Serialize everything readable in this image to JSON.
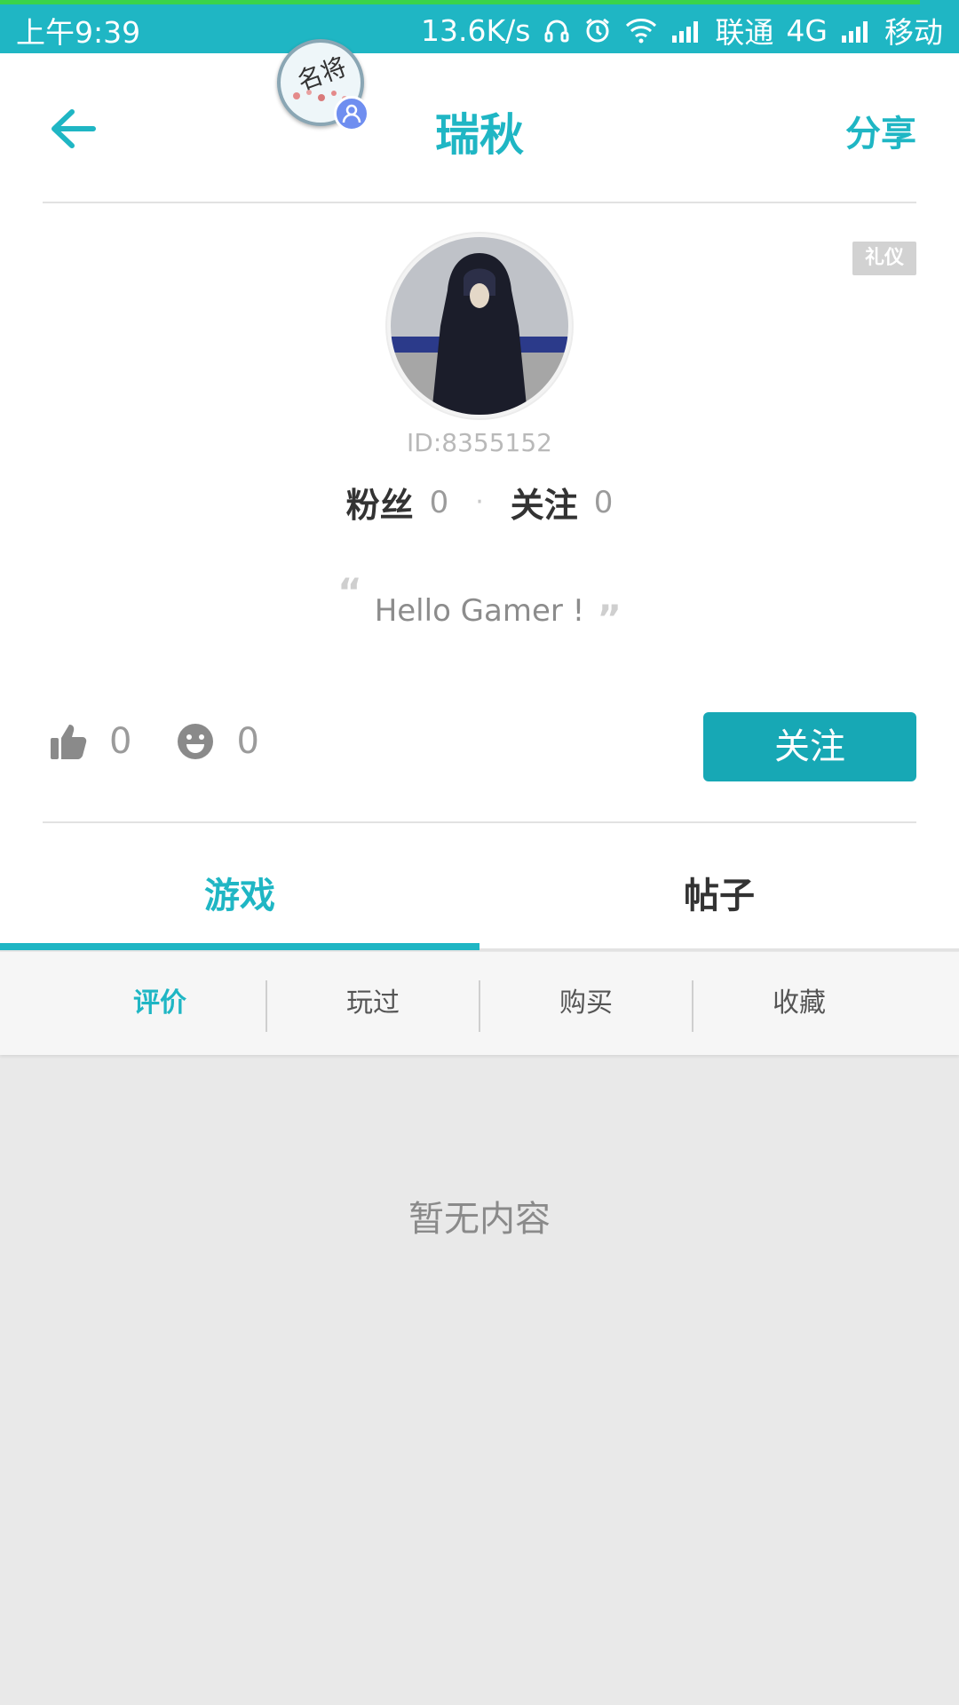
{
  "status_bar": {
    "time": "上午9:39",
    "speed": "13.6K/s",
    "carrier1": "联通",
    "network": "4G",
    "carrier2": "移动"
  },
  "header": {
    "title": "瑞秋",
    "share_label": "分享",
    "badge_text": "名将"
  },
  "profile": {
    "tag": "礼仪",
    "user_id": "ID:8355152",
    "fans_label": "粉丝",
    "fans_count": "0",
    "separator": "·",
    "following_label": "关注",
    "following_count": "0",
    "bio": "Hello Gamer !",
    "quote_open": "“",
    "quote_close": "”",
    "likes": "0",
    "smiles": "0",
    "follow_button": "关注"
  },
  "tabs": {
    "game": "游戏",
    "posts": "帖子"
  },
  "subtabs": [
    "评价",
    "玩过",
    "购买",
    "收藏"
  ],
  "empty_text": "暂无内容",
  "colors": {
    "accent": "#1fb6c4",
    "button": "#17a8b5"
  }
}
